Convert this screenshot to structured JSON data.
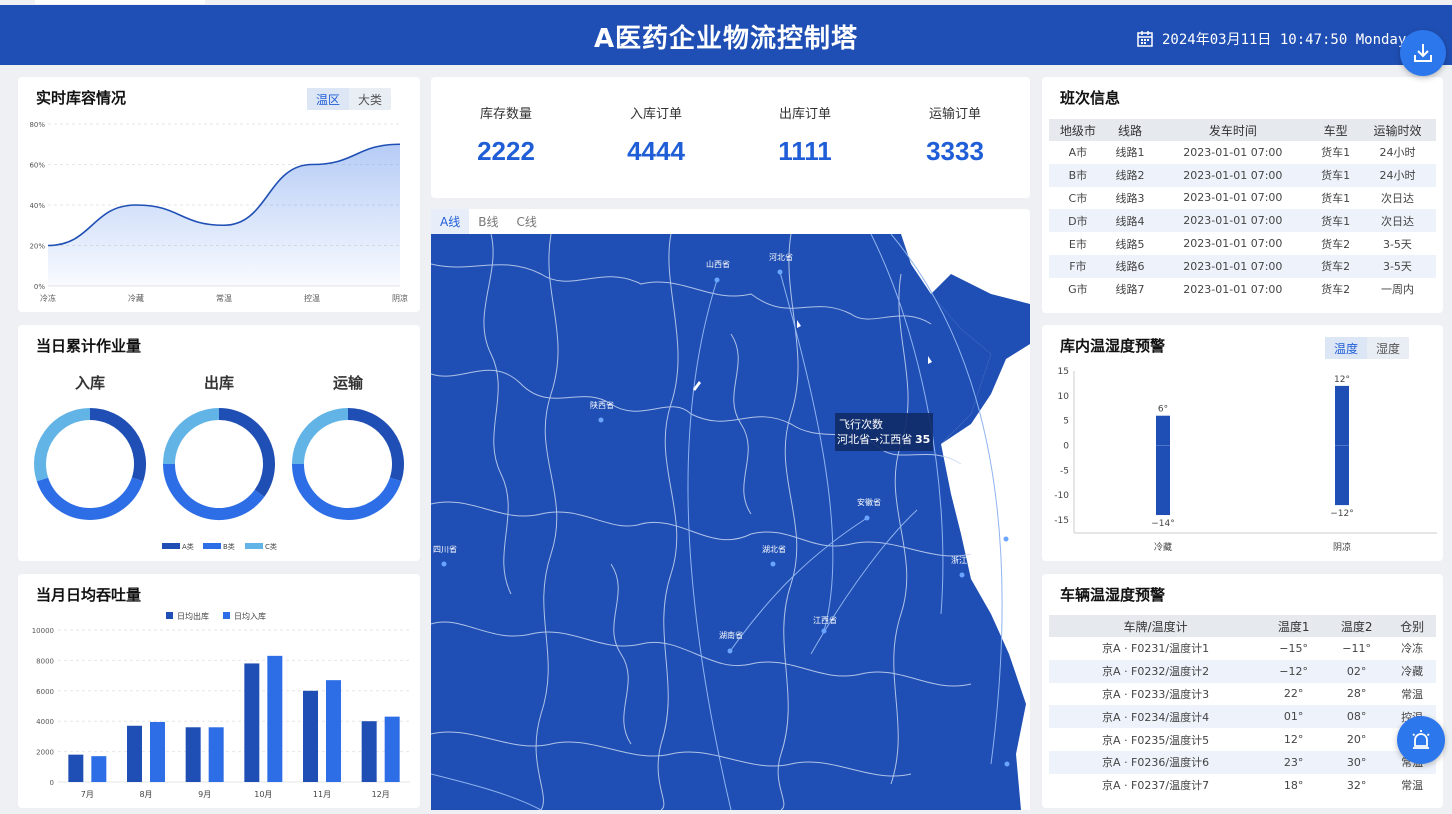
{
  "header": {
    "title": "A医药企业物流控制塔",
    "datetime": "2024年03月11日 10:47:50 Monday"
  },
  "inventory": {
    "title": "实时库容情况",
    "toggle": [
      "温区",
      "大类"
    ],
    "chart_data": {
      "type": "area",
      "categories": [
        "冷冻",
        "冷藏",
        "常温",
        "控温",
        "阴凉"
      ],
      "values": [
        20,
        40,
        30,
        60,
        70
      ],
      "yticks": [
        "0%",
        "20%",
        "40%",
        "60%",
        "80%"
      ],
      "ylim": [
        0,
        80
      ]
    }
  },
  "workload": {
    "title": "当日累计作业量",
    "legend": [
      "A类",
      "B类",
      "C类"
    ],
    "colors": [
      "#1f4fb4",
      "#2d6ee6",
      "#62b3e6"
    ],
    "charts": [
      {
        "label": "入库",
        "values": [
          30,
          40,
          30
        ]
      },
      {
        "label": "出库",
        "values": [
          35,
          40,
          25
        ]
      },
      {
        "label": "运输",
        "values": [
          30,
          45,
          25
        ]
      }
    ]
  },
  "throughput": {
    "title": "当月日均吞吐量",
    "chart_data": {
      "type": "bar",
      "categories": [
        "7月",
        "8月",
        "9月",
        "10月",
        "11月",
        "12月"
      ],
      "series": [
        {
          "name": "日均出库",
          "values": [
            1800,
            3700,
            3600,
            7800,
            6000,
            4000
          ],
          "color": "#1f4fb4"
        },
        {
          "name": "日均入库",
          "values": [
            1700,
            3950,
            3600,
            8300,
            6700,
            4300
          ],
          "color": "#2d6ee6"
        }
      ],
      "yticks": [
        "0",
        "2000",
        "4000",
        "6000",
        "8000",
        "10000"
      ],
      "ylim": [
        0,
        10000
      ]
    }
  },
  "kpis": [
    {
      "label": "库存数量",
      "value": "2222"
    },
    {
      "label": "入库订单",
      "value": "4444"
    },
    {
      "label": "出库订单",
      "value": "1111"
    },
    {
      "label": "运输订单",
      "value": "3333"
    }
  ],
  "map": {
    "tabs": [
      "A线",
      "B线",
      "C线"
    ],
    "provinces": [
      "山西省",
      "河北省",
      "陕西省",
      "安徽省",
      "四川省",
      "湖北省",
      "浙江省",
      "江西省",
      "湖南省"
    ],
    "tooltip": {
      "title": "飞行次数",
      "text": "河北省→江西省",
      "value": "35"
    }
  },
  "shifts": {
    "title": "班次信息",
    "columns": [
      "地级市",
      "线路",
      "发车时间",
      "车型",
      "运输时效"
    ],
    "rows": [
      [
        "A市",
        "线路1",
        "2023-01-01 07:00",
        "货车1",
        "24小时"
      ],
      [
        "B市",
        "线路2",
        "2023-01-01 07:00",
        "货车1",
        "24小时"
      ],
      [
        "C市",
        "线路3",
        "2023-01-01 07:00",
        "货车1",
        "次日达"
      ],
      [
        "D市",
        "线路4",
        "2023-01-01 07:00",
        "货车1",
        "次日达"
      ],
      [
        "E市",
        "线路5",
        "2023-01-01 07:00",
        "货车2",
        "3-5天"
      ],
      [
        "F市",
        "线路6",
        "2023-01-01 07:00",
        "货车2",
        "3-5天"
      ],
      [
        "G市",
        "线路7",
        "2023-01-01 07:00",
        "货车2",
        "一周内"
      ]
    ]
  },
  "warehouse_temp": {
    "title": "库内温湿度预警",
    "toggle": [
      "温度",
      "湿度"
    ],
    "chart_data": {
      "type": "bar",
      "categories": [
        "冷藏",
        "阴凉"
      ],
      "max": [
        6,
        12
      ],
      "min": [
        -14,
        -12
      ],
      "max_labels": [
        "6°",
        "12°"
      ],
      "min_labels": [
        "−14°",
        "−12°"
      ],
      "yticks": [
        "15",
        "10",
        "5",
        "0",
        "-5",
        "-10",
        "-15"
      ],
      "ylim": [
        -15,
        15
      ]
    }
  },
  "vehicle_temp": {
    "title": "车辆温湿度预警",
    "columns": [
      "车牌/温度计",
      "温度1",
      "温度2",
      "仓别"
    ],
    "rows": [
      [
        "京A · F0231/温度计1",
        "−15°",
        "−11°",
        "冷冻"
      ],
      [
        "京A · F0232/温度计2",
        "−12°",
        "02°",
        "冷藏"
      ],
      [
        "京A · F0233/温度计3",
        "22°",
        "28°",
        "常温"
      ],
      [
        "京A · F0234/温度计4",
        "01°",
        "08°",
        "控温"
      ],
      [
        "京A · F0235/温度计5",
        "12°",
        "20°",
        "阴"
      ],
      [
        "京A · F0236/温度计6",
        "23°",
        "30°",
        "常温"
      ],
      [
        "京A · F0237/温度计7",
        "18°",
        "32°",
        "常温"
      ]
    ]
  }
}
